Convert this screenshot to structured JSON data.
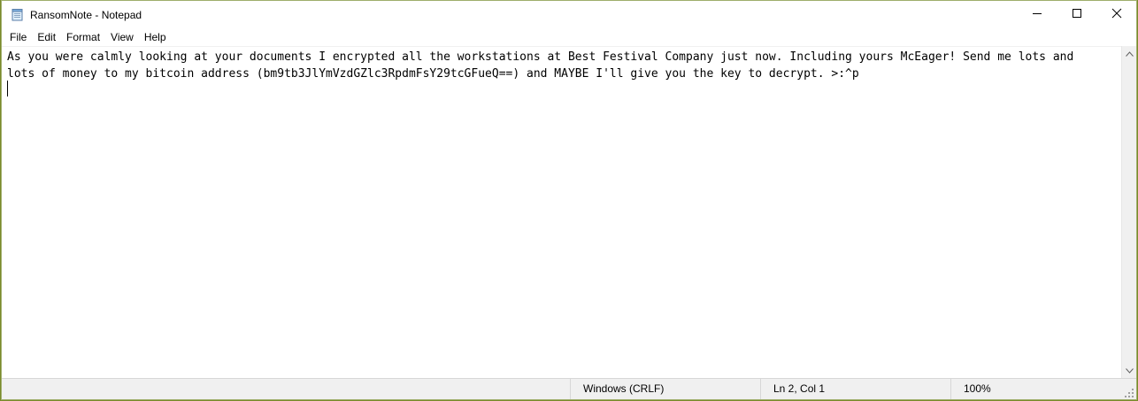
{
  "window": {
    "title": "RansomNote - Notepad",
    "app_icon": "notepad-icon",
    "controls": {
      "minimize_icon": "minimize-icon",
      "maximize_icon": "maximize-icon",
      "close_icon": "close-icon"
    }
  },
  "menu": {
    "items": [
      {
        "label": "File"
      },
      {
        "label": "Edit"
      },
      {
        "label": "Format"
      },
      {
        "label": "View"
      },
      {
        "label": "Help"
      }
    ]
  },
  "editor": {
    "content": "As you were calmly looking at your documents I encrypted all the workstations at Best Festival Company just now. Including yours McEager! Send me lots and\nlots of money to my bitcoin address (bm9tb3JlYmVzdGZlc3RpdmFsY29tcGFueQ==) and MAYBE I'll give you the key to decrypt. >:^p\n"
  },
  "statusbar": {
    "encoding": "Windows (CRLF)",
    "position": "Ln 2, Col 1",
    "zoom": "100%"
  }
}
